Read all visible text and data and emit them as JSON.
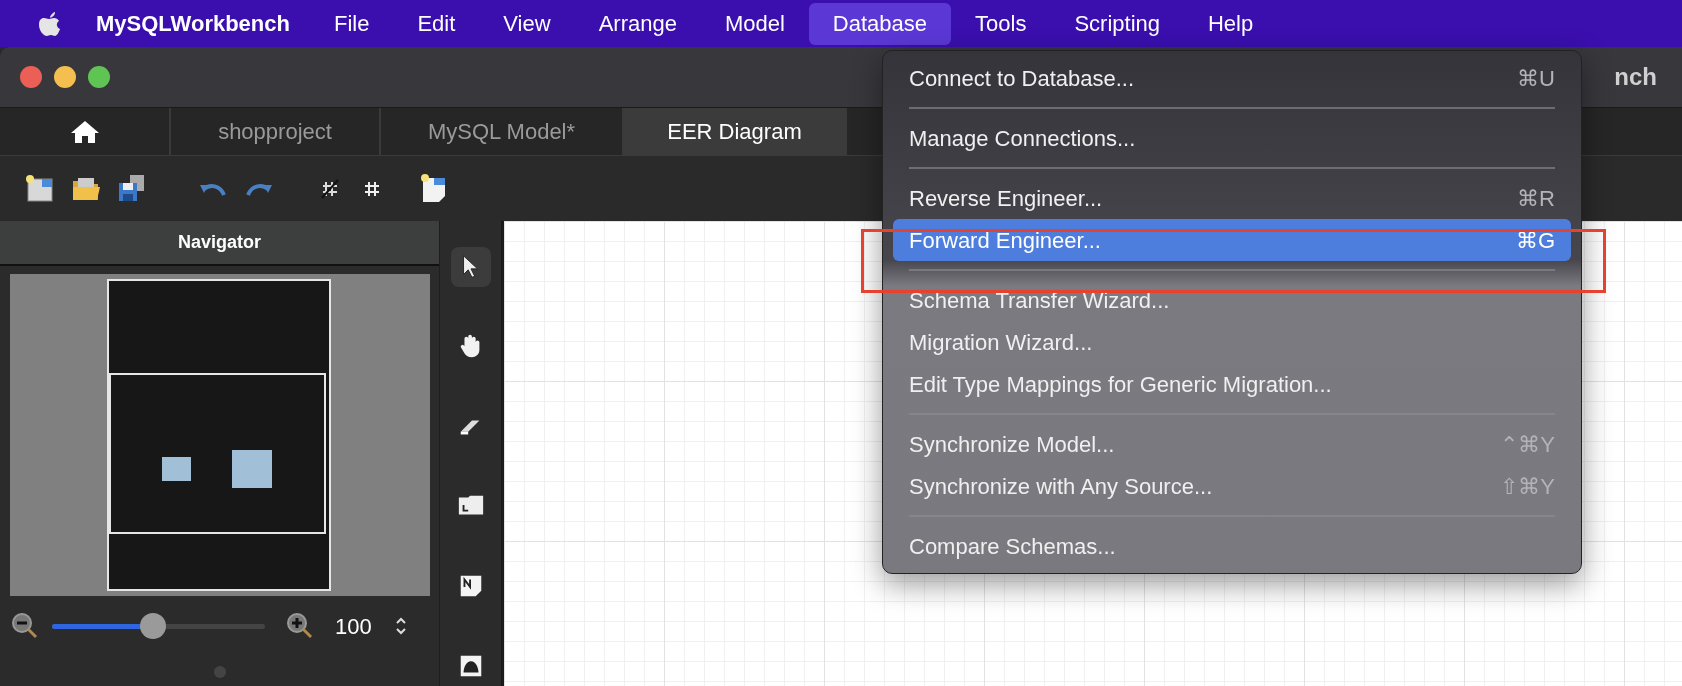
{
  "menu_bar": {
    "app_name": "MySQLWorkbench",
    "items": [
      {
        "label": "File",
        "selected": false
      },
      {
        "label": "Edit",
        "selected": false
      },
      {
        "label": "View",
        "selected": false
      },
      {
        "label": "Arrange",
        "selected": false
      },
      {
        "label": "Model",
        "selected": false
      },
      {
        "label": "Database",
        "selected": true
      },
      {
        "label": "Tools",
        "selected": false
      },
      {
        "label": "Scripting",
        "selected": false
      },
      {
        "label": "Help",
        "selected": false
      }
    ]
  },
  "window": {
    "title": "nch"
  },
  "tabs": [
    {
      "kind": "home",
      "selected": false
    },
    {
      "kind": "text",
      "label": "shopproject",
      "selected": false
    },
    {
      "kind": "text",
      "label": "MySQL Model*",
      "selected": false
    },
    {
      "kind": "text",
      "label": "EER Diagram",
      "selected": true
    }
  ],
  "navigator": {
    "title": "Navigator",
    "zoom": {
      "level": 0.47,
      "value": "100"
    }
  },
  "tools": [
    {
      "kind": "pointer",
      "selected": true
    },
    {
      "kind": "hand",
      "selected": false
    },
    {
      "kind": "eraser",
      "selected": false
    },
    {
      "kind": "layer",
      "selected": false
    },
    {
      "kind": "note",
      "selected": false
    },
    {
      "kind": "image",
      "selected": false
    }
  ],
  "dropdown_menu": {
    "items": [
      {
        "kind": "item",
        "label": "Connect to Database...",
        "shortcut": "⌘U",
        "selected": false
      },
      {
        "kind": "separator"
      },
      {
        "kind": "item",
        "label": "Manage Connections...",
        "selected": false
      },
      {
        "kind": "separator"
      },
      {
        "kind": "item",
        "label": "Reverse Engineer...",
        "shortcut": "⌘R",
        "selected": false
      },
      {
        "kind": "item",
        "label": "Forward Engineer...",
        "shortcut": "⌘G",
        "selected": true
      },
      {
        "kind": "separator"
      },
      {
        "kind": "item",
        "label": "Schema Transfer Wizard...",
        "selected": false
      },
      {
        "kind": "item",
        "label": "Migration Wizard...",
        "selected": false
      },
      {
        "kind": "item",
        "label": "Edit Type Mappings for Generic Migration...",
        "selected": false
      },
      {
        "kind": "separator"
      },
      {
        "kind": "item",
        "label": "Synchronize Model...",
        "shortcut": "⌃⌘Y",
        "selected": false
      },
      {
        "kind": "item",
        "label": "Synchronize with Any Source...",
        "shortcut": "⇧⌘Y",
        "selected": false
      },
      {
        "kind": "separator"
      },
      {
        "kind": "item",
        "label": "Compare Schemas...",
        "selected": false
      }
    ]
  }
}
